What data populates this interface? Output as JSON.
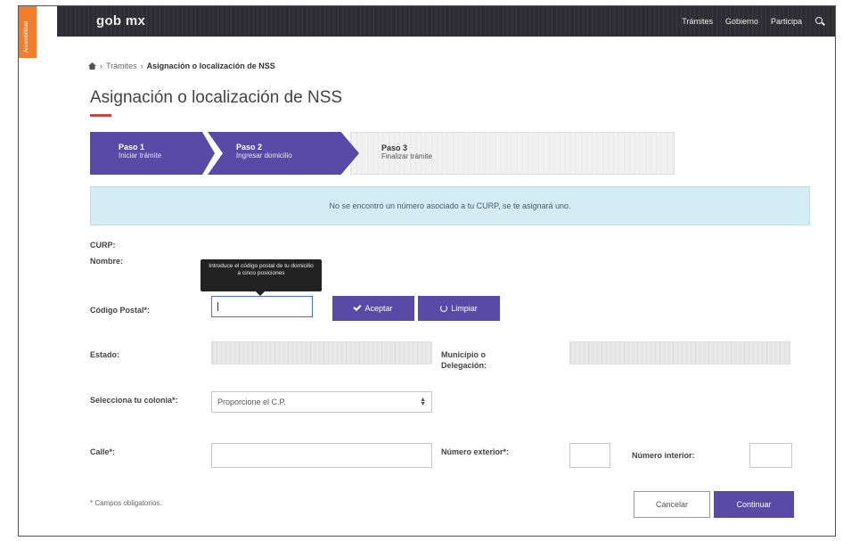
{
  "colors": {
    "primary": "#5a4aa8",
    "topbar": "#2d2d33",
    "accent_tab": "#ef7d2c",
    "title_underline": "#c94a38",
    "alert_bg": "#d4ecf3"
  },
  "side_tab": {
    "label": "Accesibilidad"
  },
  "header": {
    "logo": "gob mx",
    "nav": [
      "Trámites",
      "Gobierno",
      "Participa"
    ],
    "search_icon": "search-icon"
  },
  "breadcrumb": {
    "home_icon": "home-icon",
    "items": [
      "Trámites",
      "Asignación o localización de NSS"
    ]
  },
  "page": {
    "title": "Asignación o localización de NSS"
  },
  "steps": [
    {
      "title": "Paso 1",
      "subtitle": "Iniciar trámite"
    },
    {
      "title": "Paso 2",
      "subtitle": "Ingresar domicilio"
    },
    {
      "title": "Paso 3",
      "subtitle": "Finalizar trámite"
    }
  ],
  "alert": {
    "text": "No se encontró un número asociado a tu CURP, se te asignará uno."
  },
  "form": {
    "curp_label": "CURP:",
    "nombre_label": "Nombre:",
    "tooltip": "Introduce el código postal de tu domicilio a cinco posiciones",
    "cp_label": "Código Postal*:",
    "cp_value": "",
    "aceptar": "Aceptar",
    "limpiar": "Limpiar",
    "estado_label": "Estado:",
    "municipio_label": "Municipio o Delegación:",
    "colonia_label": "Selecciona tu colonia*:",
    "colonia_selected": "Proporcione el C.P.",
    "calle_label": "Calle*:",
    "num_ext_label": "Número exterior*:",
    "num_int_label": "Número interior:"
  },
  "footer": {
    "note": "* Campos obligatorios.",
    "cancel": "Cancelar",
    "continue": "Continuar"
  }
}
